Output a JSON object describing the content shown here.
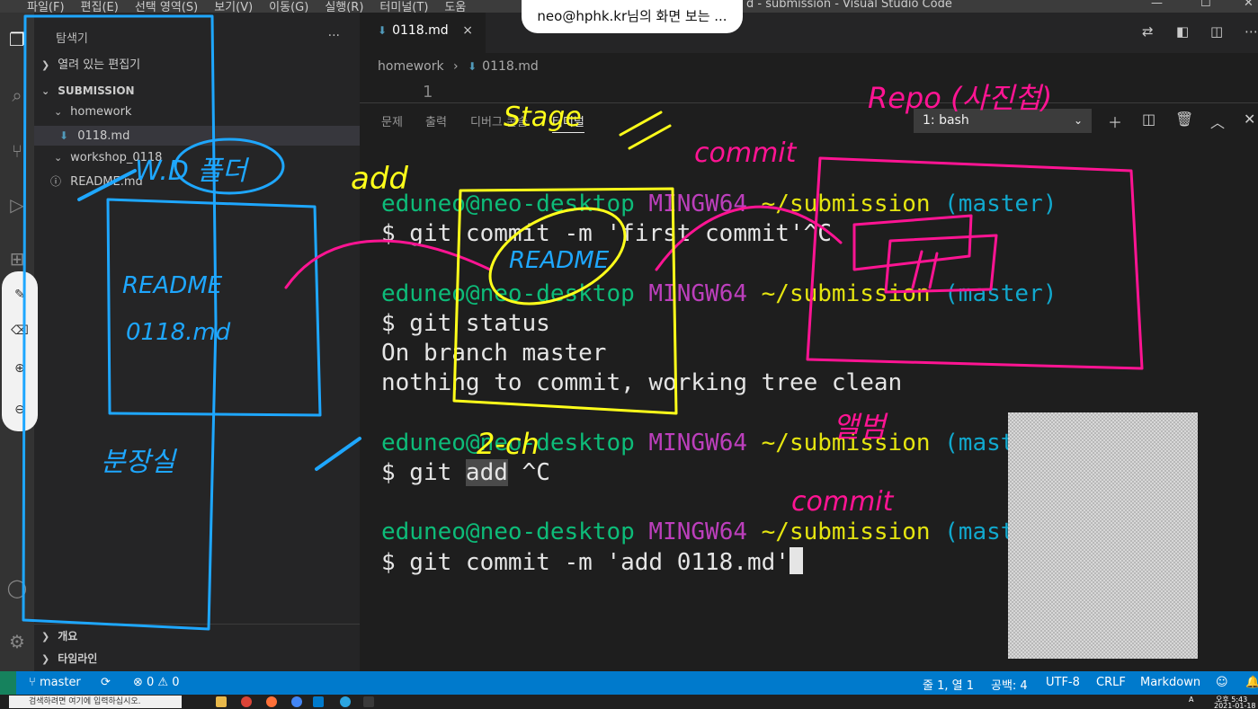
{
  "window": {
    "menu": [
      "파일(F)",
      "편집(E)",
      "선택 영역(S)",
      "보기(V)",
      "이동(G)",
      "실행(R)",
      "터미널(T)",
      "도움"
    ],
    "title": "d - submission - Visual Studio Code"
  },
  "screen_share": {
    "label": "neo@hphk.kr님의 화면 보는 ..."
  },
  "sidebar": {
    "header": "탐색기",
    "more": "...",
    "open_editors": "열려 있는 편집기",
    "folder": "SUBMISSION",
    "items": [
      {
        "label": "homework"
      },
      {
        "label": "0118.md"
      },
      {
        "label": "workshop_0118"
      },
      {
        "label": "README.md"
      }
    ],
    "outline": "개요",
    "timeline": "타임라인"
  },
  "editor": {
    "tab_label": "0118.md",
    "close": "×",
    "breadcrumb_folder": "homework",
    "breadcrumb_sep": "›",
    "breadcrumb_file": "0118.md",
    "line_number": "1"
  },
  "panel": {
    "tabs": [
      "문제",
      "출력",
      "디버그 콘솔",
      "터미널"
    ],
    "terminal_select": "1: bash",
    "terminal_lines": [
      {
        "user": "eduneo@neo-desktop",
        "env": "MINGW64",
        "path": "~/submission",
        "branch": "(master)"
      },
      {
        "cmd": "$ git commit -m 'first commit'^C"
      },
      {
        "user": "eduneo@neo-desktop",
        "env": "MINGW64",
        "path": "~/submission",
        "branch": "(master)"
      },
      {
        "cmd": "$ git status"
      },
      {
        "out1": "On branch master"
      },
      {
        "out2": "nothing to commit, working tree clean"
      },
      {
        "user": "eduneo@neo-desktop",
        "env": "MINGW64",
        "path": "~/submission",
        "branch": "(maste"
      },
      {
        "cmd_a": "$ git ",
        "cmd_sel": "add",
        "cmd_b": " ^C"
      },
      {
        "user": "eduneo@neo-desktop",
        "env": "MINGW64",
        "path": "~/submission",
        "branch": "(maste"
      },
      {
        "cmd": "$ git commit -m 'add 0118.md'"
      }
    ]
  },
  "annotations": {
    "blue": [
      "W.D 폴더",
      "README",
      "0118.md",
      "분장실"
    ],
    "yellow": [
      "add",
      "Stage",
      "README",
      "2-ch"
    ],
    "pink": [
      "Repo (사진첩)",
      "commit",
      "앨범",
      "commit"
    ]
  },
  "statusbar": {
    "branch": "master",
    "problems": "⊗ 0 ⚠ 0",
    "position": "줄 1, 열 1",
    "spaces": "공백: 4",
    "encoding": "UTF-8",
    "eol": "CRLF",
    "language": "Markdown"
  },
  "taskbar": {
    "search_placeholder": "검색하려면 여기에 입력하십시오.",
    "time": "오후 5:43",
    "date": "2021-01-18",
    "lang": "A"
  },
  "colors": {
    "annotation_blue": "#1ea7ff",
    "annotation_yellow": "#ffff1a",
    "annotation_pink": "#ff1493",
    "statusbar": "#007acc"
  }
}
